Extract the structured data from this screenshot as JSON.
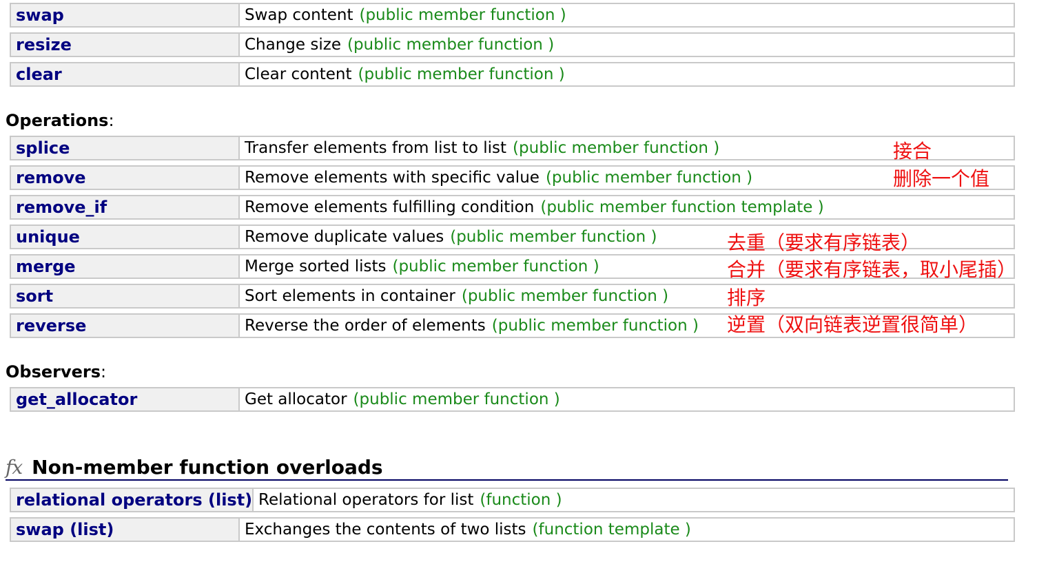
{
  "top_rows": [
    {
      "name": "swap",
      "desc": "Swap content",
      "kind": "(public member function )"
    },
    {
      "name": "resize",
      "desc": "Change size",
      "kind": "(public member function )"
    },
    {
      "name": "clear",
      "desc": "Clear content",
      "kind": "(public member function )"
    }
  ],
  "operations": {
    "title": "Operations",
    "colon": ":",
    "rows": [
      {
        "name": "splice",
        "desc": "Transfer elements from list to list",
        "kind": "(public member function )"
      },
      {
        "name": "remove",
        "desc": "Remove elements with specific value",
        "kind": "(public member function )"
      },
      {
        "name": "remove_if",
        "desc": "Remove elements fulfilling condition",
        "kind": "(public member function template )"
      },
      {
        "name": "unique",
        "desc": "Remove duplicate values",
        "kind": "(public member function )"
      },
      {
        "name": "merge",
        "desc": "Merge sorted lists",
        "kind": "(public member function )"
      },
      {
        "name": "sort",
        "desc": "Sort elements in container",
        "kind": "(public member function )"
      },
      {
        "name": "reverse",
        "desc": "Reverse the order of elements",
        "kind": "(public member function )"
      }
    ]
  },
  "observers": {
    "title": "Observers",
    "colon": ":",
    "rows": [
      {
        "name": "get_allocator",
        "desc": "Get allocator",
        "kind": "(public member function )"
      }
    ]
  },
  "non_member": {
    "icon": "fx",
    "heading": "Non-member function overloads",
    "rows": [
      {
        "name": "relational operators (list)",
        "desc": "Relational operators for list",
        "kind": "(function )"
      },
      {
        "name": "swap (list)",
        "desc": "Exchanges the contents of two lists",
        "kind": "(function template )"
      }
    ]
  },
  "annotations": {
    "splice": "接合",
    "remove": "删除一个值",
    "unique": "去重（要求有序链表）",
    "merge": "合并（要求有序链表，取小尾插）",
    "sort": "排序",
    "reverse": "逆置（双向链表逆置很简单）"
  },
  "colors": {
    "name_text": "#000080",
    "kind_text": "#1a8a1a",
    "annotation_text": "#ee1111",
    "name_cell_bg": "#f0f0f0",
    "border": "#c9c9c9"
  }
}
